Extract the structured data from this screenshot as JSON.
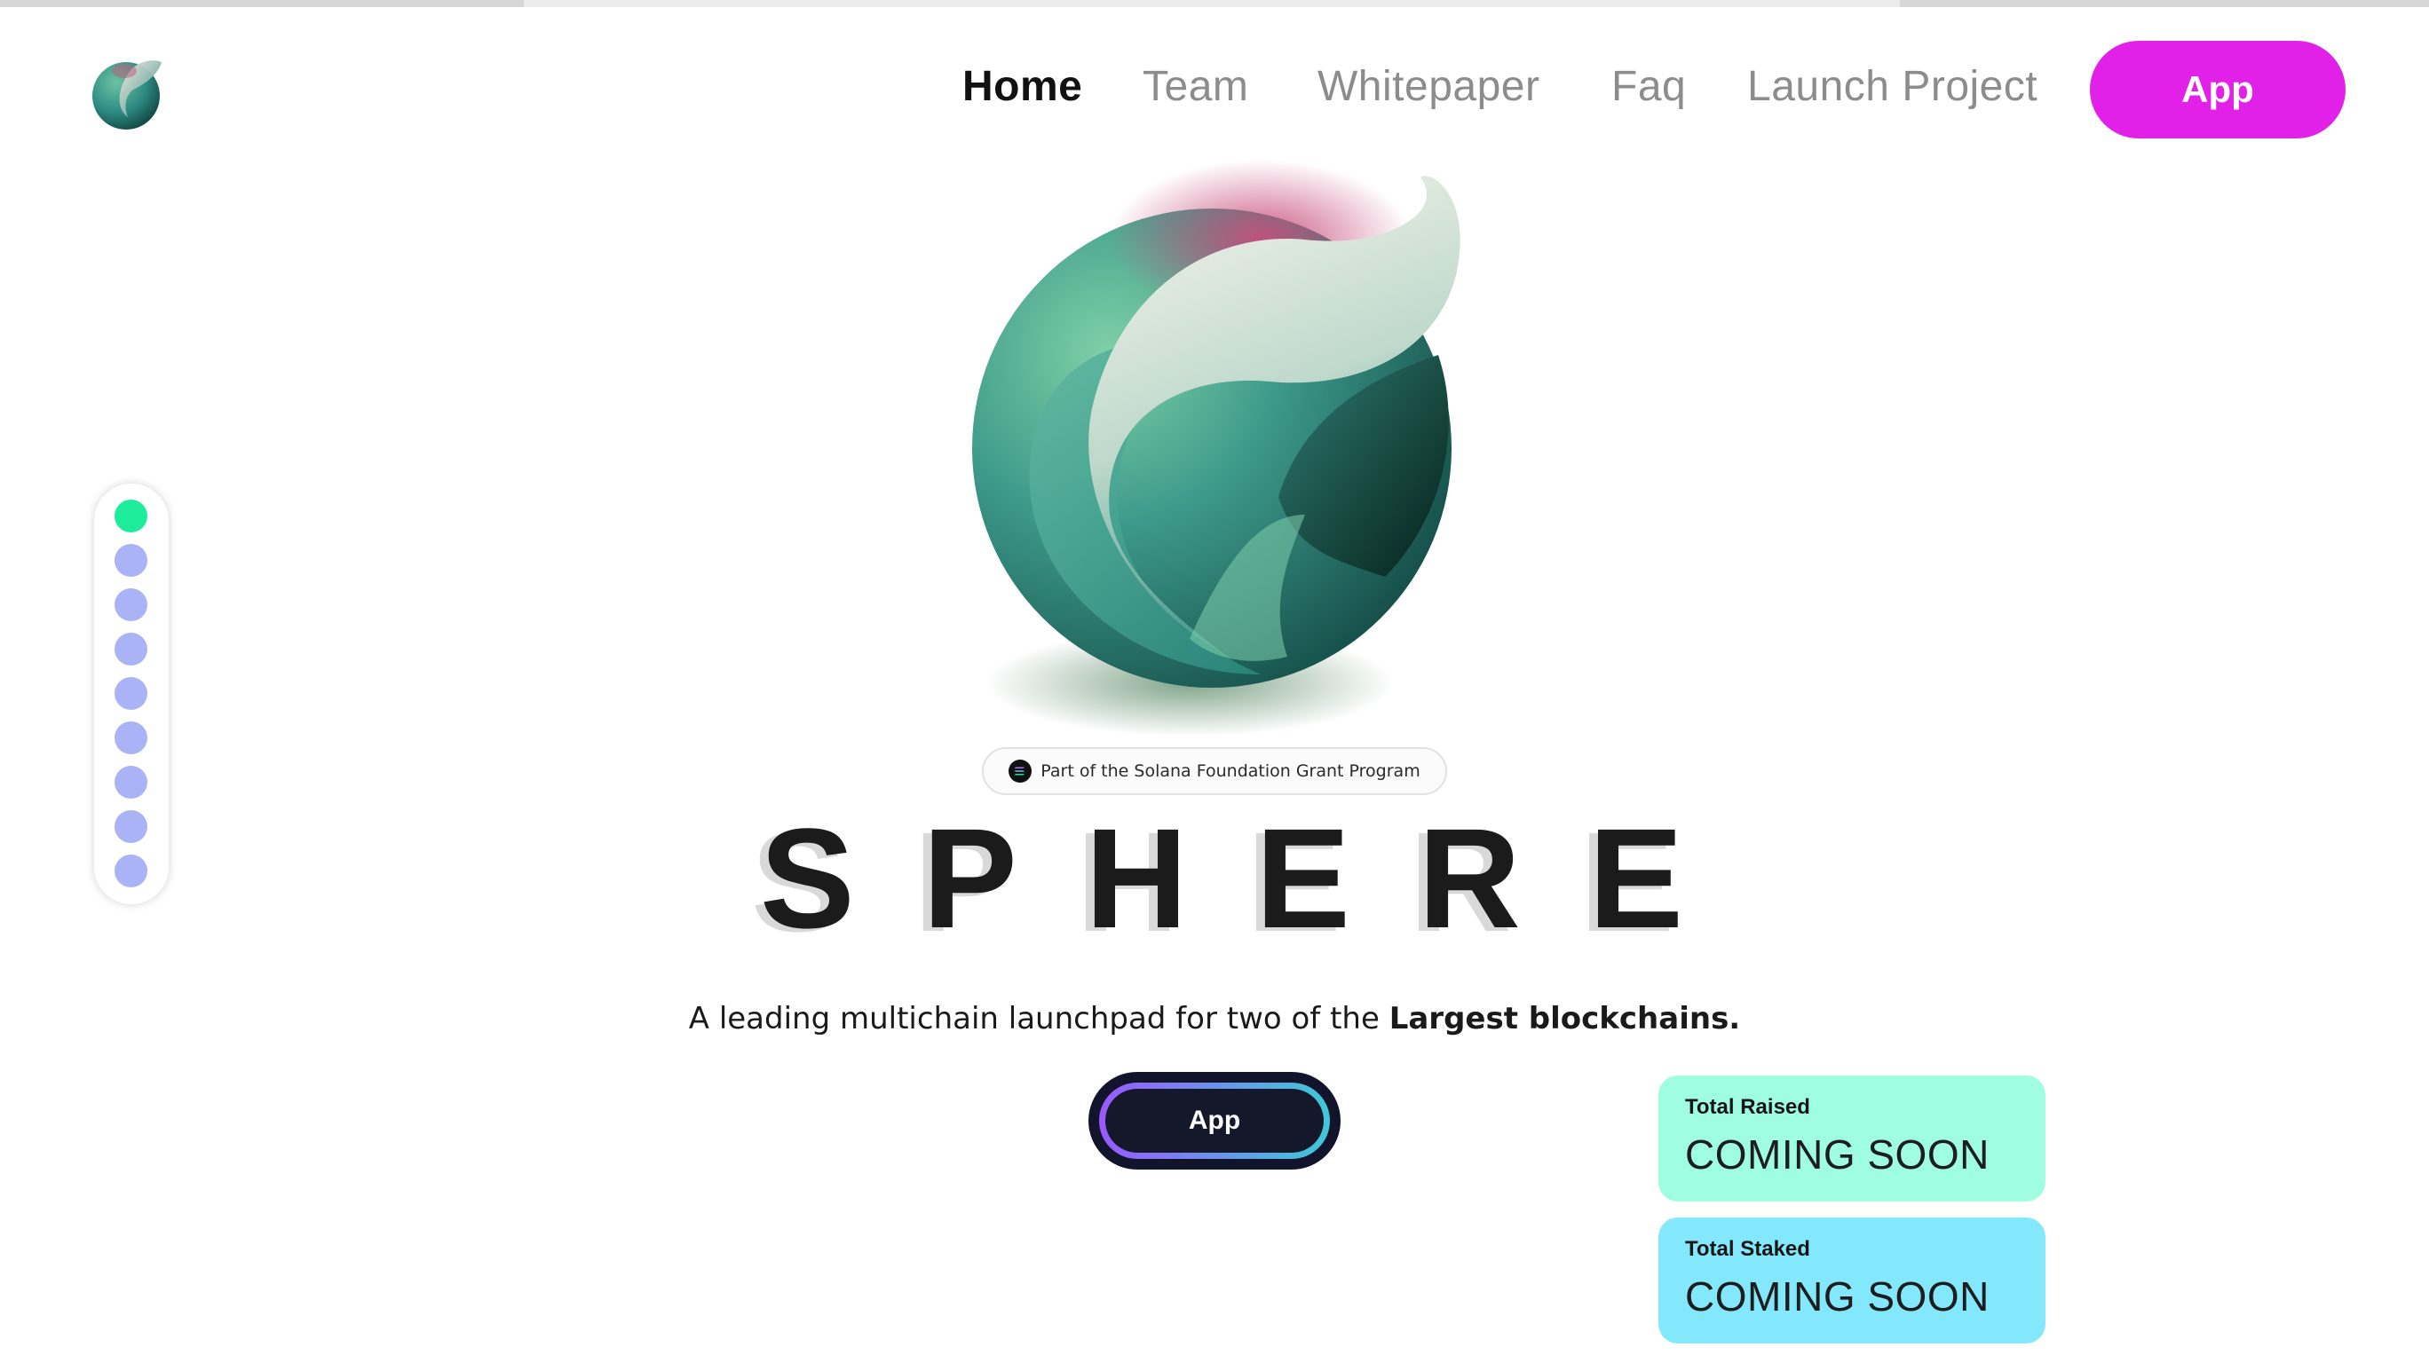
{
  "nav": {
    "items": [
      {
        "label": "Home",
        "active": true
      },
      {
        "label": "Team",
        "active": false
      },
      {
        "label": "Whitepaper",
        "active": false
      },
      {
        "label": "Faq",
        "active": false
      },
      {
        "label": "Launch Project",
        "active": false
      }
    ],
    "app_button": "App"
  },
  "icons": {
    "logo": "sphere-logo-icon",
    "hero": "sphere-hero-icon",
    "badge": "solana-icon"
  },
  "section_nav": {
    "count": 9,
    "active_index": 0
  },
  "hero": {
    "badge_text": "Part of the Solana Foundation Grant Program",
    "title_letters": [
      "S",
      "P",
      "H",
      "E",
      "R",
      "E"
    ],
    "subtitle_prefix": "A leading multichain launchpad for two of the ",
    "subtitle_bold": "Largest blockchains.",
    "app_button": "App"
  },
  "stats": {
    "total_raised": {
      "label": "Total Raised",
      "value": "COMING SOON"
    },
    "total_staked": {
      "label": "Total Staked",
      "value": "COMING SOON"
    }
  },
  "colors": {
    "accent_magenta": "#e221e8",
    "dot_active": "#1ded9a",
    "dot_inactive": "#a9b3f5",
    "stat_raised_bg": "#9ffde0",
    "stat_staked_bg": "#84e8fd"
  }
}
